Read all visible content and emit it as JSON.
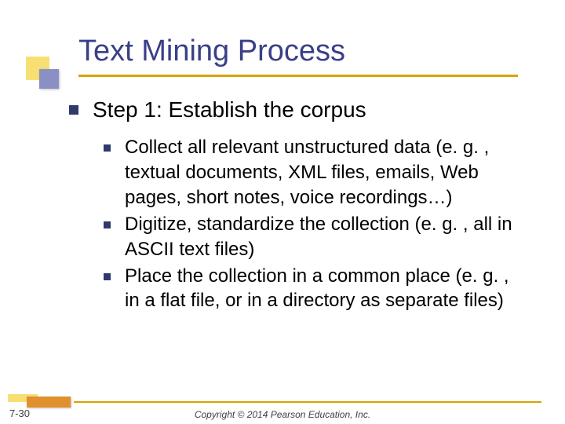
{
  "title": "Text Mining Process",
  "step_heading": "Step 1: Establish the corpus",
  "bullets": [
    "Collect all relevant unstructured data (e. g. , textual documents, XML files, emails, Web pages, short notes, voice recordings…)",
    "Digitize, standardize the collection (e. g. , all in ASCII text files)",
    "Place the collection in a common place (e. g. , in a flat file, or in a directory as separate files)"
  ],
  "page_number": "7-30",
  "copyright": "Copyright © 2014 Pearson Education, Inc."
}
